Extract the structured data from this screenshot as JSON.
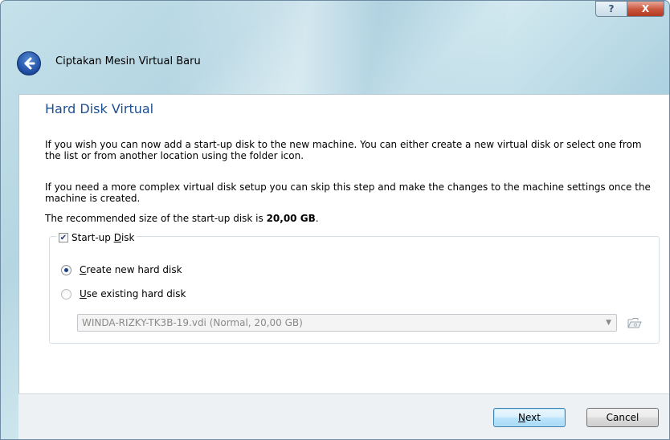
{
  "window": {
    "title": "Ciptakan Mesin Virtual Baru",
    "help_glyph": "?",
    "close_glyph": "X"
  },
  "page": {
    "heading": "Hard Disk Virtual",
    "paragraph1": "If you wish you can now add a start-up disk to the new machine. You can either create a new virtual disk or select one from the list or from another location using the folder icon.",
    "paragraph2": "If you need a more complex virtual disk setup you can skip this step and make the changes to the machine settings once the machine is created.",
    "recommended_prefix": "The recommended size of the start-up disk is ",
    "recommended_value": "20,00 GB",
    "recommended_suffix": "."
  },
  "startup_disk": {
    "checked": true,
    "label_pre": "Start-up ",
    "label_accel": "D",
    "label_post": "isk",
    "create_option": {
      "accel": "C",
      "rest": "reate new hard disk",
      "selected": true
    },
    "existing_option": {
      "accel": "U",
      "rest": "se existing hard disk",
      "selected": false
    },
    "existing_disk_value": "WINDA-RIZKY-TK3B-19.vdi (Normal, 20,00 GB)",
    "folder_icon": "folder-icon"
  },
  "buttons": {
    "next_accel": "N",
    "next_rest": "ext",
    "cancel": "Cancel"
  },
  "colors": {
    "heading": "#1d4f91",
    "accent": "#3c7fb1"
  }
}
